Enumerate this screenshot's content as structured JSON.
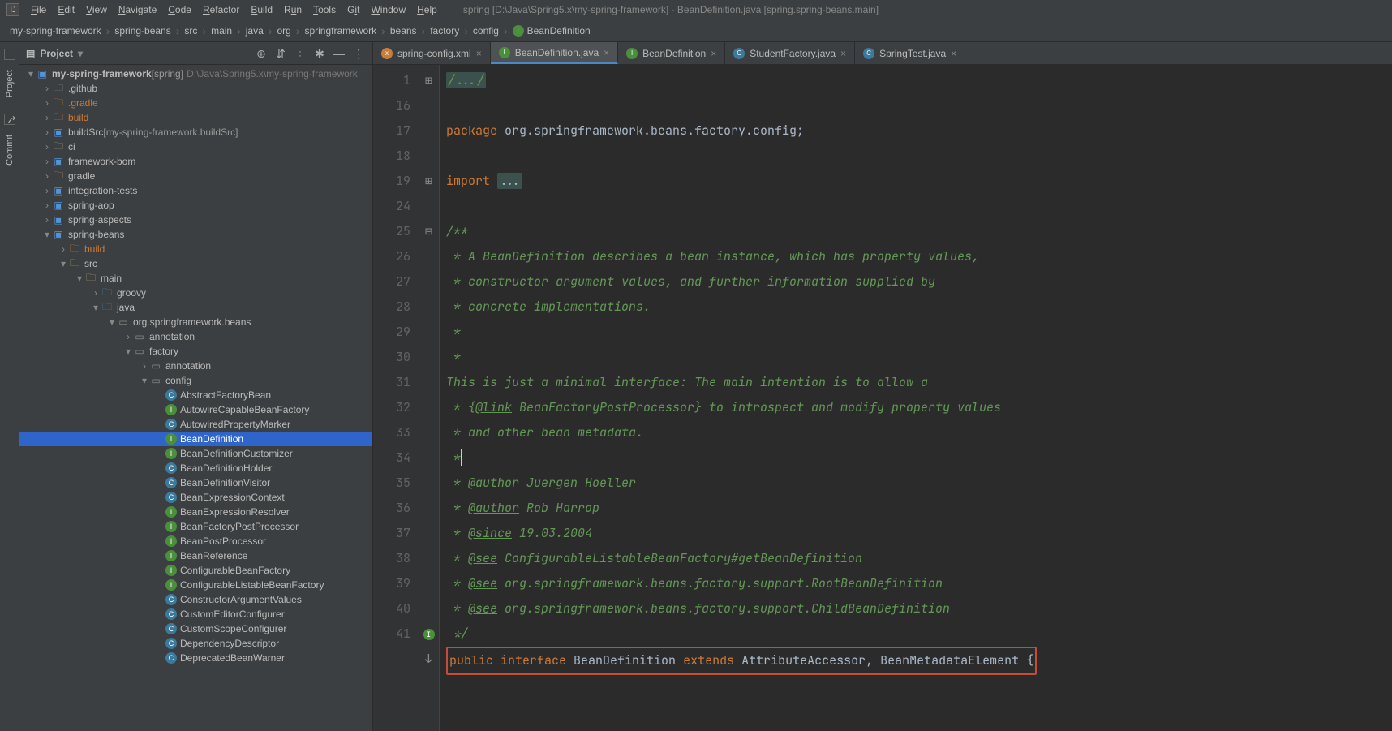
{
  "menu": {
    "items": [
      "File",
      "Edit",
      "View",
      "Navigate",
      "Code",
      "Refactor",
      "Build",
      "Run",
      "Tools",
      "Git",
      "Window",
      "Help"
    ],
    "title": "spring [D:\\Java\\Spring5.x\\my-spring-framework] - BeanDefinition.java [spring.spring-beans.main]"
  },
  "breadcrumbs": [
    "my-spring-framework",
    "spring-beans",
    "src",
    "main",
    "java",
    "org",
    "springframework",
    "beans",
    "factory",
    "config",
    "BeanDefinition"
  ],
  "project": {
    "label": "Project",
    "root_name": "my-spring-framework",
    "root_tag": "[spring]",
    "root_path": "D:\\Java\\Spring5.x\\my-spring-framework",
    "nodes": {
      "github": ".github",
      "gradle": ".gradle",
      "build": "build",
      "buildSrc": "buildSrc",
      "buildSrc_tag": "[my-spring-framework.buildSrc]",
      "ci": "ci",
      "framework_bom": "framework-bom",
      "gradle2": "gradle",
      "integration_tests": "integration-tests",
      "spring_aop": "spring-aop",
      "spring_aspects": "spring-aspects",
      "spring_beans": "spring-beans",
      "sb_build": "build",
      "src": "src",
      "main": "main",
      "groovy": "groovy",
      "java": "java",
      "pkg": "org.springframework.beans",
      "annotation": "annotation",
      "factory": "factory",
      "annotation2": "annotation",
      "config": "config"
    },
    "config_files": [
      {
        "name": "AbstractFactoryBean",
        "type": "class"
      },
      {
        "name": "AutowireCapableBeanFactory",
        "type": "interface"
      },
      {
        "name": "AutowiredPropertyMarker",
        "type": "class"
      },
      {
        "name": "BeanDefinition",
        "type": "interface",
        "selected": true
      },
      {
        "name": "BeanDefinitionCustomizer",
        "type": "interface"
      },
      {
        "name": "BeanDefinitionHolder",
        "type": "class"
      },
      {
        "name": "BeanDefinitionVisitor",
        "type": "class"
      },
      {
        "name": "BeanExpressionContext",
        "type": "class"
      },
      {
        "name": "BeanExpressionResolver",
        "type": "interface"
      },
      {
        "name": "BeanFactoryPostProcessor",
        "type": "interface"
      },
      {
        "name": "BeanPostProcessor",
        "type": "interface"
      },
      {
        "name": "BeanReference",
        "type": "interface"
      },
      {
        "name": "ConfigurableBeanFactory",
        "type": "interface"
      },
      {
        "name": "ConfigurableListableBeanFactory",
        "type": "interface"
      },
      {
        "name": "ConstructorArgumentValues",
        "type": "class"
      },
      {
        "name": "CustomEditorConfigurer",
        "type": "class"
      },
      {
        "name": "CustomScopeConfigurer",
        "type": "class"
      },
      {
        "name": "DependencyDescriptor",
        "type": "class"
      },
      {
        "name": "DeprecatedBeanWarner",
        "type": "class"
      }
    ]
  },
  "sidebar": {
    "project": "Project",
    "commit": "Commit"
  },
  "tabs": [
    {
      "icon": "xml",
      "label": "spring-config.xml"
    },
    {
      "icon": "java-i",
      "label": "BeanDefinition.java",
      "active": true
    },
    {
      "icon": "java-i",
      "label": "BeanDefinition"
    },
    {
      "icon": "java-c",
      "label": "StudentFactory.java"
    },
    {
      "icon": "java-c",
      "label": "SpringTest.java"
    }
  ],
  "code": {
    "lines": [
      "1",
      "16",
      "17",
      "18",
      "19",
      "24",
      "25",
      "26",
      "27",
      "28",
      "29",
      "30",
      "31",
      "32",
      "33",
      "34",
      "35",
      "36",
      "37",
      "38",
      "39",
      "40",
      "41"
    ],
    "l1": "/.../",
    "l17_kw": "package",
    "l17_rest": " org.springframework.beans.factory.config;",
    "l19_kw": "import",
    "l19_fold": "...",
    "l25": "/**",
    "l26": " * A BeanDefinition describes a bean instance, which has property values,",
    "l27": " * constructor argument values, and further information supplied by",
    "l28": " * concrete implementations.",
    "l29": " *",
    "l30": " * <p>This is just a minimal interface: The main intention is to allow a",
    "l31a": " * {",
    "l31tag": "@link",
    "l31b": " BeanFactoryPostProcessor} to introspect and modify property values",
    "l32": " * and other bean metadata.",
    "l33": " *",
    "l34a": " * ",
    "l34tag": "@author",
    "l34b": " Juergen Hoeller",
    "l35a": " * ",
    "l35tag": "@author",
    "l35b": " Rob Harrop",
    "l36a": " * ",
    "l36tag": "@since",
    "l36b": " 19.03.2004",
    "l37a": " * ",
    "l37tag": "@see",
    "l37b": " ConfigurableListableBeanFactory#getBeanDefinition",
    "l38a": " * ",
    "l38tag": "@see",
    "l38b": " org.springframework.beans.factory.support.RootBeanDefinition",
    "l39a": " * ",
    "l39tag": "@see",
    "l39b": " org.springframework.beans.factory.support.ChildBeanDefinition",
    "l40": " */",
    "l41_public": "public",
    "l41_interface": "interface",
    "l41_name": "BeanDefinition",
    "l41_extends": "extends",
    "l41_rest": "AttributeAccessor, BeanMetadataElement {"
  }
}
